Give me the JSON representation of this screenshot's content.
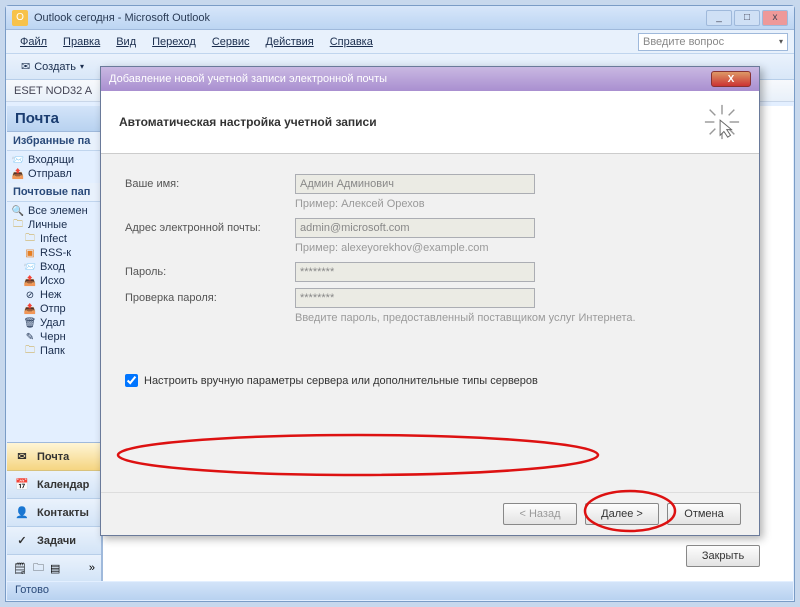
{
  "window": {
    "title": "Outlook сегодня - Microsoft Outlook"
  },
  "menu": {
    "file": "Файл",
    "edit": "Правка",
    "view": "Вид",
    "go": "Переход",
    "service": "Сервис",
    "actions": "Действия",
    "help": "Справка",
    "ask_placeholder": "Введите вопрос"
  },
  "toolbar": {
    "create": "Создать"
  },
  "eset": {
    "label": "ESET NOD32 A"
  },
  "nav": {
    "mail": "Почта",
    "favorites": "Избранные па",
    "inbox": "Входящи",
    "sent": "Отправл",
    "mail_folders": "Почтовые пап",
    "all_items": "Все элемен",
    "personal": "Личные",
    "infect": "Infect",
    "rss": "RSS-к",
    "inbox2": "Вход",
    "outbox": "Исхо",
    "unwanted": "Неж",
    "sent2": "Отпр",
    "deleted": "Удал",
    "drafts": "Черн",
    "search_folders": "Папк",
    "btn_mail": "Почта",
    "btn_calendar": "Календар",
    "btn_contacts": "Контакты",
    "btn_tasks": "Задачи"
  },
  "dialog": {
    "title": "Добавление новой учетной записи электронной почты",
    "header": "Автоматическая настройка учетной записи",
    "name_label": "Ваше имя:",
    "name_value": "Админ Админович",
    "name_hint": "Пример: Алексей Орехов",
    "email_label": "Адрес электронной почты:",
    "email_value": "admin@microsoft.com",
    "email_hint": "Пример: alexeyorekhov@example.com",
    "password_label": "Пароль:",
    "password_value": "********",
    "password2_label": "Проверка пароля:",
    "password2_value": "********",
    "password_hint": "Введите пароль, предоставленный поставщиком услуг Интернета.",
    "manual_checkbox": "Настроить вручную параметры сервера или дополнительные типы серверов",
    "back": "< Назад",
    "next": "Далее >",
    "cancel": "Отмена"
  },
  "other": {
    "close": "Закрыть"
  },
  "status": {
    "ready": "Готово"
  }
}
